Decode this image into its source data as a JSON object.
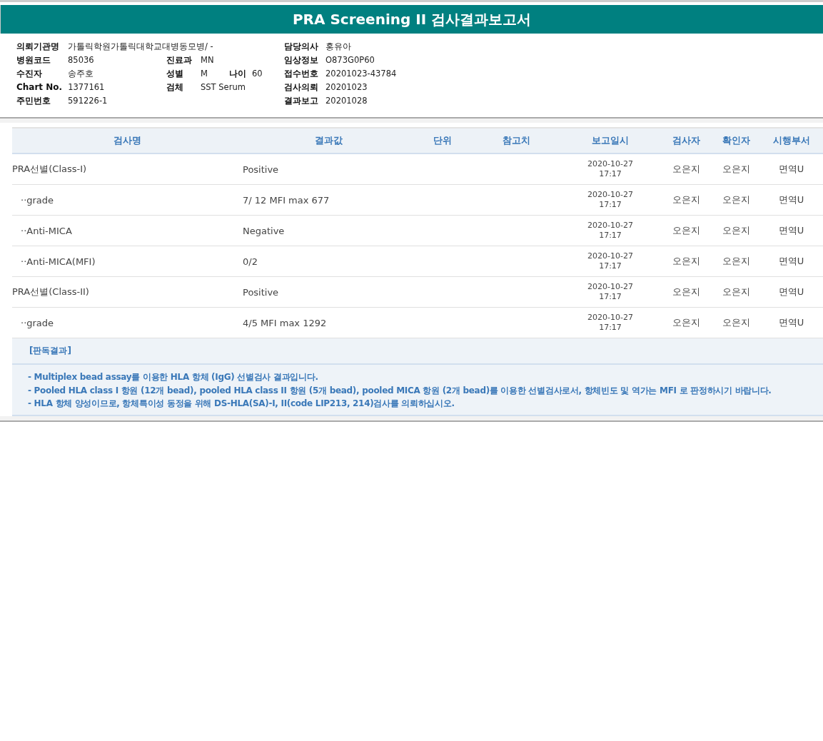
{
  "title": "PRA Screening II 검사결과보고서",
  "info": {
    "rows": [
      {
        "left": {
          "label": "의뢰기관명",
          "value": "가톨릭학원가톨릭대학교대병동모병/ -"
        },
        "right": {
          "label": "담당의사",
          "value": "홍유아"
        }
      },
      {
        "left": {
          "label": "병원코드",
          "value": "85036"
        },
        "middle": {
          "label": "진료과",
          "value": "MN"
        },
        "right": {
          "label": "임상정보",
          "value": "O873G0P60"
        }
      },
      {
        "left": {
          "label": "수진자",
          "value": "송주호"
        },
        "middle": {
          "label": "성별",
          "value": "M",
          "extra": {
            "label": "나이",
            "value": "60"
          }
        },
        "right": {
          "label": "접수번호",
          "value": "20201023-43784"
        }
      },
      {
        "left": {
          "label": "Chart No.",
          "value": "1377161"
        },
        "middle": {
          "label": "검체",
          "value": "SST Serum"
        },
        "right": {
          "label": "검사의뢰",
          "value": "20201023"
        }
      },
      {
        "left": {
          "label": "주민번호",
          "value": "591226-1"
        },
        "right": {
          "label": "결과보고",
          "value": "20201028"
        }
      }
    ]
  },
  "table": {
    "columns": [
      "검사명",
      "결과값",
      "단위",
      "참고치",
      "보고일시",
      "검사자",
      "확인자",
      "시행부서"
    ],
    "rows": [
      {
        "name": "PRA선별(Class-I)",
        "result": "Positive",
        "date": "2020-10-27",
        "time": "17:17",
        "tester": "오은지",
        "confirmer": "오은지",
        "dept": "면역U",
        "children": [
          {
            "name": "··grade",
            "result": "7/ 12 MFI max 677",
            "date": "2020-10-27",
            "time": "17:17",
            "tester": "오은지",
            "confirmer": "오은지",
            "dept": "면역U"
          },
          {
            "name": "··Anti-MICA",
            "result": "Negative",
            "date": "2020-10-27",
            "time": "17:17",
            "tester": "오은지",
            "confirmer": "오은지",
            "dept": "면역U"
          },
          {
            "name": "··Anti-MICA(MFI)",
            "result": "0/2",
            "date": "2020-10-27",
            "time": "17:17",
            "tester": "오은지",
            "confirmer": "오은지",
            "dept": "면역U"
          }
        ]
      },
      {
        "name": "PRA선별(Class-II)",
        "result": "Positive",
        "date": "2020-10-27",
        "time": "17:17",
        "tester": "오은지",
        "confirmer": "오은지",
        "dept": "면역U",
        "children": [
          {
            "name": "··grade",
            "result": "4/5 MFI max 1292",
            "date": "2020-10-27",
            "time": "17:17",
            "tester": "오은지",
            "confirmer": "오은지",
            "dept": "면역U"
          }
        ]
      }
    ]
  },
  "interpretation": {
    "heading": "[판독결과]",
    "lines": [
      "- Multiplex bead assay를 이용한 HLA 항체 (IgG) 선별검사 결과입니다.",
      "- Pooled HLA class I 항원 (12개 bead), pooled HLA class II 항원 (5개 bead), pooled MICA 항원 (2개 bead)를 이용한 선별검사로서, 항체빈도 및 역가는 MFI 로 판정하시기 바랍니다.",
      "- HLA 항체 양성이므로, 항체특이성 동정을 위해 DS-HLA(SA)-I, II(code LIP213, 214)검사를 의뢰하십시오."
    ]
  }
}
